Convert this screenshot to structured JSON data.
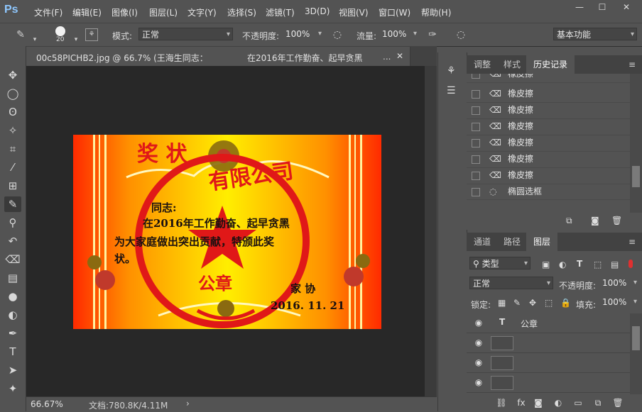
{
  "app": {
    "logo": "Ps"
  },
  "menu": [
    "文件(F)",
    "编辑(E)",
    "图像(I)",
    "图层(L)",
    "文字(Y)",
    "选择(S)",
    "滤镜(T)",
    "3D(D)",
    "视图(V)",
    "窗口(W)",
    "帮助(H)"
  ],
  "window_controls": [
    "minimize-icon",
    "maximize-icon",
    "close-icon"
  ],
  "options_bar": {
    "brush_size": "20",
    "mode_label": "模式:",
    "mode_value": "正常",
    "opacity_label": "不透明度:",
    "opacity_value": "100%",
    "flow_label": "流量:",
    "flow_value": "100%",
    "workspace_value": "基本功能"
  },
  "document": {
    "tab_title": "00c58PICHB2.jpg @ 66.7% (王海生同志：",
    "tab_title_rest": "在2016年工作勤奋、起早贪黑",
    "tab_more": "...",
    "zoom": "66.67%",
    "doc_info": "文档:780.8K/4.11M"
  },
  "certificate": {
    "title": "奖 状",
    "greeting": "同志:",
    "line1": "在2016年工作勤奋、起早贪黑",
    "line2": "为大家庭做出突出贡献，特颁此奖",
    "line3": "状。",
    "issuer": "家 协",
    "date": "2016. 11. 21",
    "seal_top": "有限公司",
    "seal_bottom": "公章"
  },
  "history_panel": {
    "tabs": [
      "调整",
      "样式",
      "历史记录"
    ],
    "active_tab": "历史记录",
    "items": [
      "橡皮擦",
      "橡皮擦",
      "橡皮擦",
      "橡皮擦",
      "橡皮擦",
      "橡皮擦",
      "橡皮擦",
      "椭圆选框"
    ]
  },
  "layers_panel": {
    "tabs": [
      "通道",
      "路径",
      "图层"
    ],
    "active_tab": "图层",
    "filter_kind": "类型",
    "blend_mode": "正常",
    "opacity_label": "不透明度:",
    "opacity_value": "100%",
    "lock_label": "锁定:",
    "fill_label": "填充:",
    "fill_value": "100%",
    "layers": [
      {
        "type": "text",
        "name": "公章"
      },
      {
        "type": "pixel",
        "name": ""
      },
      {
        "type": "pixel",
        "name": ""
      },
      {
        "type": "pixel",
        "name": ""
      }
    ]
  },
  "colors": {
    "ui_bg": "#535353",
    "canvas_bg": "#282828",
    "accent_red": "#e01818",
    "cert_yellow": "#ffe000"
  }
}
